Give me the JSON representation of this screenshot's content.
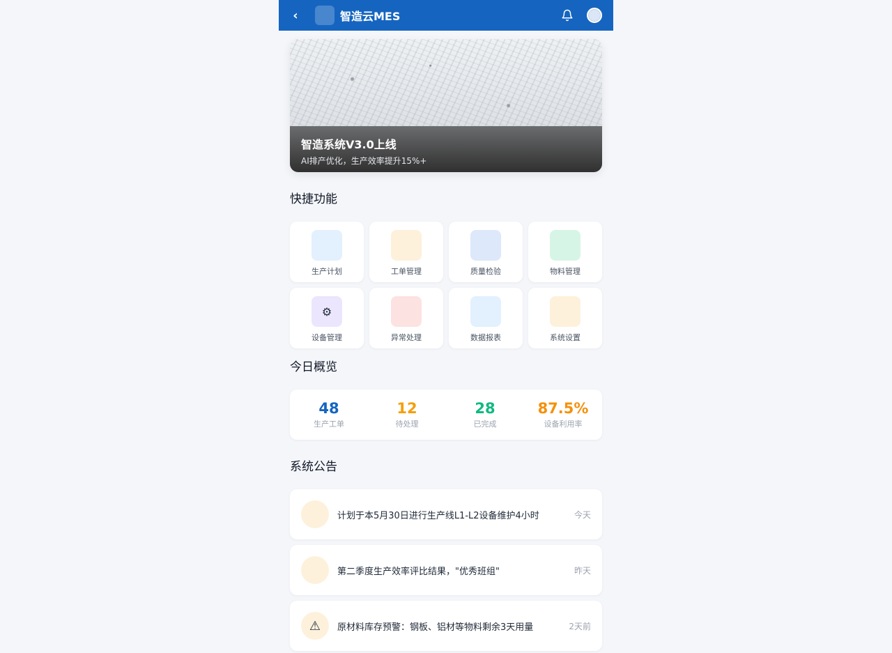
{
  "topbar": {
    "back_icon": "‹",
    "logo_glyph": "",
    "title": "智造云MES"
  },
  "banner": {
    "title": " 智造系统V3.0上线",
    "subtitle": "AI排产优化，生产效率提升15%+"
  },
  "quick": {
    "title": "快捷功能",
    "items": [
      {
        "label": "生产计划",
        "glyph": "",
        "icon": "plan-icon",
        "bg": "#e3f0fd"
      },
      {
        "label": "工单管理",
        "glyph": "",
        "icon": "workorder-icon",
        "bg": "#fdf1dc"
      },
      {
        "label": "质量检验",
        "glyph": "",
        "icon": "quality-icon",
        "bg": "#dde8fb"
      },
      {
        "label": "物料管理",
        "glyph": "",
        "icon": "material-icon",
        "bg": "#d6f5e6"
      },
      {
        "label": "设备管理",
        "glyph": "⚙",
        "icon": "gear-icon",
        "bg": "#ebe6fd"
      },
      {
        "label": "异常处理",
        "glyph": "",
        "icon": "alert-icon",
        "bg": "#fde2e2"
      },
      {
        "label": "数据报表",
        "glyph": "",
        "icon": "report-icon",
        "bg": "#e3f0fd"
      },
      {
        "label": "系统设置",
        "glyph": "",
        "icon": "settings-icon",
        "bg": "#fdf1dc"
      }
    ]
  },
  "overview": {
    "title": " 今日概览",
    "stats": [
      {
        "value": "48",
        "label": "生产工单",
        "color": "#1565c0"
      },
      {
        "value": "12",
        "label": "待处理",
        "color": "#f59e0b"
      },
      {
        "value": "28",
        "label": "已完成",
        "color": "#10b981"
      },
      {
        "value": "87.5%",
        "label": "设备利用率",
        "color": "#f5900b"
      }
    ]
  },
  "notices": {
    "title": " 系统公告",
    "items": [
      {
        "icon_glyph": "",
        "icon": "announcement-icon",
        "text": "计划于本5月30日进行生产线L1-L2设备维护4小时",
        "time": "今天"
      },
      {
        "icon_glyph": "",
        "icon": "announcement-icon",
        "text": "第二季度生产效率评比结果，\"优秀班组\"",
        "time": "昨天"
      },
      {
        "icon_glyph": "⚠",
        "icon": "warning-icon",
        "text": "原材料库存预警：钢板、铝材等物料剩余3天用量",
        "time": "2天前"
      }
    ]
  }
}
